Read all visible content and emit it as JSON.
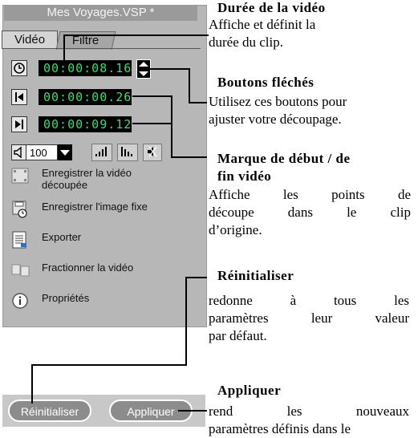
{
  "window_title": "Mes Voyages.VSP *",
  "tabs": [
    {
      "label": "Vidéo"
    },
    {
      "label": "Filtre"
    }
  ],
  "timecodes": {
    "duration": "00:00:08.16",
    "mark_in": "00:00:00.26",
    "mark_out": "00:00:09.12"
  },
  "volume": {
    "value": "100"
  },
  "menu": [
    {
      "label_line1": "Enregistrer la vidéo",
      "label_line2": "découpée",
      "icon": "film-save-icon"
    },
    {
      "label_line1": "Enregistrer l'image fixe",
      "icon": "still-image-save-icon"
    },
    {
      "label_line1": "Exporter",
      "icon": "export-icon"
    },
    {
      "label_line1": "Fractionner la vidéo",
      "icon": "split-video-icon"
    },
    {
      "label_line1": "Propriétés",
      "icon": "info-icon"
    }
  ],
  "buttons": {
    "reset": "Réinitialiser",
    "apply": "Appliquer"
  },
  "annotations": {
    "duration": {
      "title": "Durée de la vidéo",
      "line1": "Affiche et définit la",
      "line2": "durée du clip."
    },
    "arrows": {
      "title": "Boutons fléchés",
      "line1": "Utilisez ces boutons pour",
      "line2": "ajuster votre découpage."
    },
    "marks": {
      "title_line1": "Marque de début / de",
      "title_line2": "fin vidéo",
      "line1": "Affiche les points de",
      "line2": "découpe dans le clip",
      "line3": "d’origine."
    },
    "reset": {
      "title": "Réinitialiser",
      "line1": "redonne à tous les",
      "line2": "paramètres leur valeur",
      "line3": "par défaut."
    },
    "apply": {
      "title": "Appliquer",
      "line1": "rend les nouveaux",
      "line2": "paramètres définis dans le"
    }
  }
}
